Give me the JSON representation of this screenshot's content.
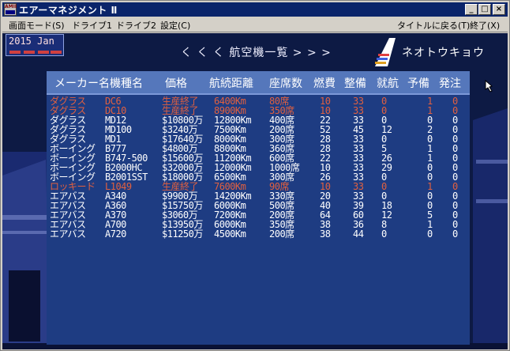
{
  "window": {
    "icon_label": "AMII",
    "title": "エアーマネジメント Ⅱ",
    "buttons": [
      "_",
      "□",
      "×"
    ]
  },
  "menubar": {
    "left": [
      "画面モード(S)",
      "ドライブ1",
      "ドライブ2",
      "設定(C)"
    ],
    "right": [
      "タイトルに戻る(T)",
      "終了(X)"
    ]
  },
  "game": {
    "date": "2015  Jan",
    "list_title": "く く く   航空機一覧   > > >",
    "company_name": "ネオトウキョウ",
    "colors": {
      "background": "#0d1a44",
      "header_bg": "#5577bb",
      "table_bg": "#1e3c82",
      "normal_text": "#ffffff",
      "discontinued_text": "#e06040"
    },
    "columns": [
      "メーカー名",
      "機種名",
      "価格",
      "航続距離",
      "座席数",
      "燃費",
      "整備",
      "就航",
      "予備",
      "発注"
    ],
    "rows": [
      {
        "status": "discontinued",
        "maker": "ダグラス",
        "model": "DC6",
        "price": "生産終了",
        "range": "6400Km",
        "seats": "80席",
        "fuel": "10",
        "maint": "33",
        "service": "0",
        "spare": "1",
        "order": "0"
      },
      {
        "status": "discontinued",
        "maker": "ダグラス",
        "model": "DC10",
        "price": "生産終了",
        "range": "8900Km",
        "seats": "350席",
        "fuel": "10",
        "maint": "33",
        "service": "0",
        "spare": "1",
        "order": "0"
      },
      {
        "status": "normal",
        "maker": "ダグラス",
        "model": "MD12",
        "price": "$10800万",
        "range": "12800Km",
        "seats": "400席",
        "fuel": "22",
        "maint": "33",
        "service": "0",
        "spare": "0",
        "order": "0"
      },
      {
        "status": "normal",
        "maker": "ダグラス",
        "model": "MD100",
        "price": "$3240万",
        "range": "7500Km",
        "seats": "200席",
        "fuel": "52",
        "maint": "45",
        "service": "12",
        "spare": "2",
        "order": "0"
      },
      {
        "status": "normal",
        "maker": "ダグラス",
        "model": "MD1",
        "price": "$17640万",
        "range": "8000Km",
        "seats": "300席",
        "fuel": "28",
        "maint": "33",
        "service": "0",
        "spare": "0",
        "order": "0"
      },
      {
        "status": "normal",
        "maker": "ボーイング",
        "model": "B777",
        "price": "$4800万",
        "range": "8800Km",
        "seats": "360席",
        "fuel": "28",
        "maint": "33",
        "service": "5",
        "spare": "1",
        "order": "0"
      },
      {
        "status": "normal",
        "maker": "ボーイング",
        "model": "B747-500",
        "price": "$15600万",
        "range": "11200Km",
        "seats": "600席",
        "fuel": "22",
        "maint": "33",
        "service": "26",
        "spare": "1",
        "order": "0"
      },
      {
        "status": "normal",
        "maker": "ボーイング",
        "model": "B2000HC",
        "price": "$32000万",
        "range": "12000Km",
        "seats": "1000席",
        "fuel": "10",
        "maint": "33",
        "service": "29",
        "spare": "0",
        "order": "0"
      },
      {
        "status": "normal",
        "maker": "ボーイング",
        "model": "B2001SST",
        "price": "$18000万",
        "range": "6500Km",
        "seats": "300席",
        "fuel": "26",
        "maint": "33",
        "service": "0",
        "spare": "0",
        "order": "0"
      },
      {
        "status": "discontinued",
        "maker": "ロッキード",
        "model": "L1049",
        "price": "生産終了",
        "range": "7600Km",
        "seats": "90席",
        "fuel": "10",
        "maint": "33",
        "service": "0",
        "spare": "1",
        "order": "0"
      },
      {
        "status": "normal",
        "maker": "エアバス",
        "model": "A340",
        "price": "$9900万",
        "range": "14200Km",
        "seats": "330席",
        "fuel": "20",
        "maint": "33",
        "service": "0",
        "spare": "0",
        "order": "0"
      },
      {
        "status": "normal",
        "maker": "エアバス",
        "model": "A360",
        "price": "$15750万",
        "range": "6000Km",
        "seats": "500席",
        "fuel": "40",
        "maint": "39",
        "service": "18",
        "spare": "0",
        "order": "0"
      },
      {
        "status": "normal",
        "maker": "エアバス",
        "model": "A370",
        "price": "$3060万",
        "range": "7200Km",
        "seats": "200席",
        "fuel": "64",
        "maint": "60",
        "service": "12",
        "spare": "5",
        "order": "0"
      },
      {
        "status": "normal",
        "maker": "エアバス",
        "model": "A700",
        "price": "$13950万",
        "range": "6000Km",
        "seats": "350席",
        "fuel": "38",
        "maint": "36",
        "service": "8",
        "spare": "1",
        "order": "0"
      },
      {
        "status": "normal",
        "maker": "エアバス",
        "model": "A720",
        "price": "$11250万",
        "range": "4500Km",
        "seats": "200席",
        "fuel": "38",
        "maint": "44",
        "service": "0",
        "spare": "0",
        "order": "0"
      }
    ]
  }
}
